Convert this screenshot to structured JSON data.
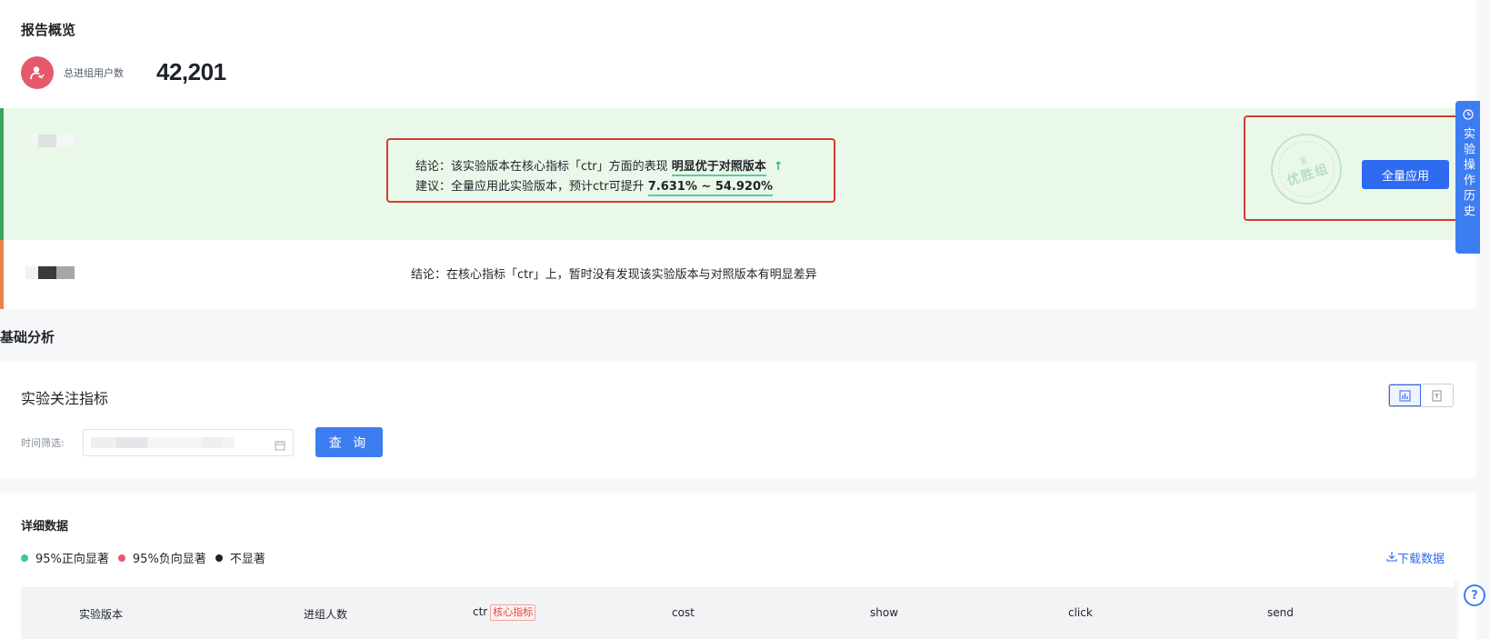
{
  "overview": {
    "title": "报告概览",
    "user_label": "总进组用户数",
    "user_count": "42,201",
    "avatar_icon": "user-icon"
  },
  "winner_row": {
    "conclusion_prefix": "结论：该实验版本在核心指标「ctr」方面的表现 ",
    "conclusion_highlight": "明显优于对照版本",
    "conclusion_arrow": "↑",
    "suggestion_prefix": "建议：全量应用此实验版本，预计ctr可提升 ",
    "suggestion_highlight": "7.631% ~ 54.920%",
    "stamp_text": "优胜组",
    "apply_label": "全量应用",
    "accent_color": "#3da35d"
  },
  "neutral_row": {
    "conclusion": "结论：在核心指标「ctr」上，暂时没有发现该实验版本与对照版本有明显差异",
    "accent_color": "#e8844a"
  },
  "side_tab": {
    "label": "实验操作历史",
    "icon": "clock-icon"
  },
  "basic_analysis": {
    "title": "基础分析",
    "metrics_title": "实验关注指标",
    "filter_label": "时间筛选:",
    "query_label": "查 询",
    "toggle_icons": [
      "bar-chart-icon",
      "bookmark-icon"
    ]
  },
  "detail": {
    "title": "详细数据",
    "legend": [
      {
        "label": "95%正向显著",
        "color": "#3fc79a"
      },
      {
        "label": "95%负向显著",
        "color": "#e45a6b"
      },
      {
        "label": "不显著",
        "color": "#1f2329"
      }
    ],
    "download_label": "下载数据",
    "columns": [
      "实验版本",
      "进组人数",
      "ctr",
      "cost",
      "show",
      "click",
      "send"
    ],
    "core_badge": "核心指标"
  },
  "help_label": "?"
}
